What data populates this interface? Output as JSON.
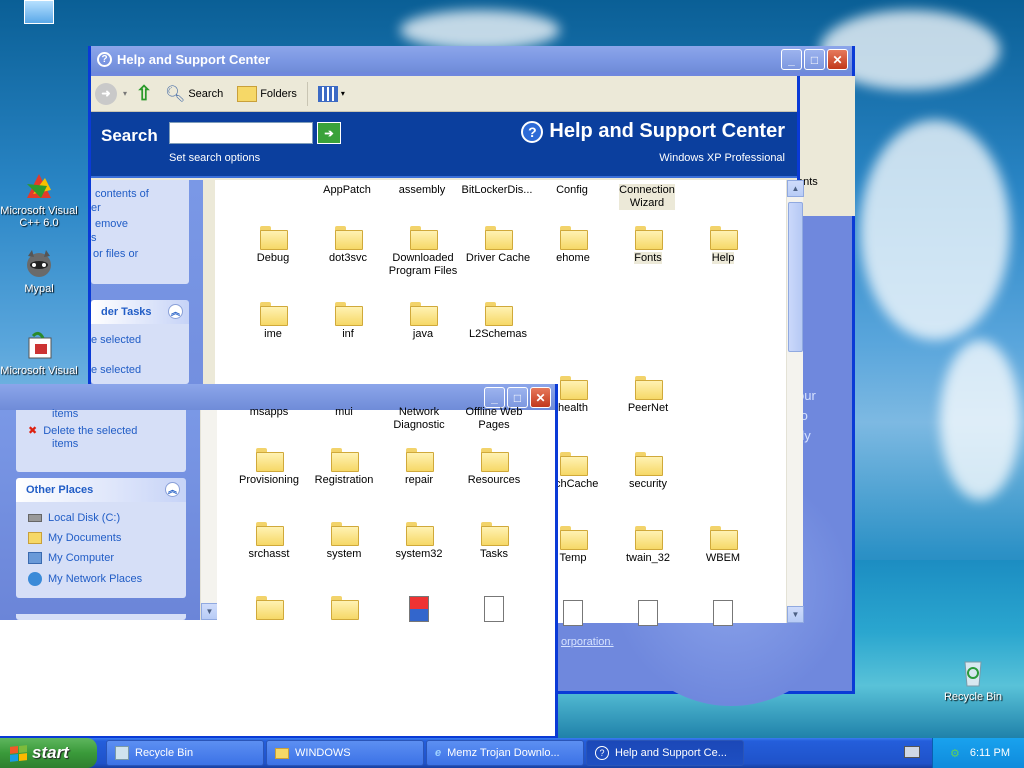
{
  "desktop": {
    "icons": [
      {
        "label": "Microsoft Visual C++ 6.0",
        "icon": "visual-cpp-icon"
      },
      {
        "label": "Mypal",
        "icon": "raccoon-icon"
      },
      {
        "label": "Microsoft Visual",
        "icon": "visual-studio-icon"
      },
      {
        "label": "Recycle Bin",
        "icon": "recycle-bin-icon"
      }
    ],
    "behind_text": [
      "ents",
      "our",
      "to",
      "rly"
    ],
    "corporation_link": "orporation."
  },
  "help_window": {
    "title": "Help and Support Center",
    "toolbar": {
      "search": "Search",
      "folders": "Folders"
    },
    "search_label": "Search",
    "search_value": "",
    "search_options": "Set search options",
    "brand_title": "Help and Support Center",
    "brand_subtitle": "Windows XP Professional"
  },
  "explorer": {
    "tasks_fragments": [
      "contents of",
      "er",
      "emove",
      "s",
      "or files or"
    ],
    "folder_tasks": {
      "header": "der Tasks",
      "links": [
        "e selected",
        "e selected"
      ]
    },
    "front_links": [
      "items",
      "Delete the selected",
      "items"
    ],
    "other_places": {
      "header": "Other Places",
      "links": [
        {
          "label": "Local Disk (C:)",
          "icon": "drive-icon"
        },
        {
          "label": "My Documents",
          "icon": "documents-icon"
        },
        {
          "label": "My Computer",
          "icon": "computer-icon"
        },
        {
          "label": "My Network Places",
          "icon": "network-icon"
        }
      ]
    },
    "top_row": [
      "AppPatch",
      "assembly",
      "BitLockerDis...",
      "Config",
      "Connection Wizard"
    ],
    "row1": [
      "Debug",
      "dot3svc",
      "Downloaded Program Files",
      "Driver Cache",
      "ehome",
      "Fonts",
      "Help"
    ],
    "row2": [
      "ime",
      "inf",
      "java",
      "L2Schemas"
    ],
    "row3": [
      "msapps",
      "mui",
      "Network Diagnostic",
      "Offline Web Pages",
      "health",
      "PeerNet"
    ],
    "row4": [
      "Provisioning",
      "Registration",
      "repair",
      "Resources",
      "SchCache",
      "security"
    ],
    "row5": [
      "srchasst",
      "system",
      "system32",
      "Tasks",
      "Temp",
      "twain_32",
      "WBEM"
    ]
  },
  "taskbar": {
    "start": "start",
    "tasks": [
      {
        "label": "Recycle Bin",
        "icon": "recycle-bin-icon"
      },
      {
        "label": "WINDOWS",
        "icon": "folder-icon"
      },
      {
        "label": "Memz Trojan Downlo...",
        "icon": "ie-icon"
      },
      {
        "label": "Help and Support Ce...",
        "icon": "help-icon"
      }
    ],
    "clock": "6:11 PM"
  }
}
